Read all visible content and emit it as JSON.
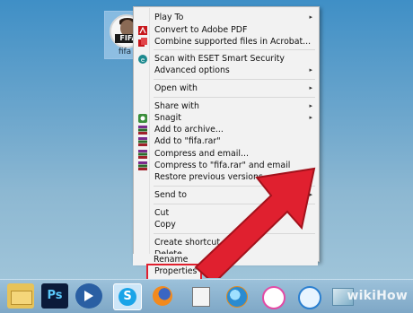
{
  "desktop": {
    "file": {
      "badge": "FIFA",
      "name": "fifa"
    }
  },
  "menu": {
    "items": [
      {
        "label": "Play To",
        "icon": "",
        "submenu": true
      },
      {
        "label": "Convert to Adobe PDF",
        "icon": "adobe-pdf-icon",
        "submenu": false
      },
      {
        "label": "Combine supported files in Acrobat...",
        "icon": "acrobat-combine-icon",
        "submenu": false
      },
      {
        "label": "Scan with ESET Smart Security",
        "icon": "eset-icon",
        "submenu": false
      },
      {
        "label": "Advanced options",
        "icon": "",
        "submenu": true
      },
      {
        "label": "Open with",
        "icon": "",
        "submenu": true
      },
      {
        "label": "Share with",
        "icon": "",
        "submenu": true
      },
      {
        "label": "Snagit",
        "icon": "snagit-icon",
        "submenu": true
      },
      {
        "label": "Add to archive...",
        "icon": "winrar-icon",
        "submenu": false
      },
      {
        "label": "Add to \"fifa.rar\"",
        "icon": "winrar-icon",
        "submenu": false
      },
      {
        "label": "Compress and email...",
        "icon": "winrar-icon",
        "submenu": false
      },
      {
        "label": "Compress to \"fifa.rar\" and email",
        "icon": "winrar-icon",
        "submenu": false
      },
      {
        "label": "Restore previous versions",
        "icon": "",
        "submenu": false
      },
      {
        "label": "Send to",
        "icon": "",
        "submenu": true
      },
      {
        "label": "Cut",
        "icon": "",
        "submenu": false
      },
      {
        "label": "Copy",
        "icon": "",
        "submenu": false
      },
      {
        "label": "Create shortcut",
        "icon": "",
        "submenu": false
      },
      {
        "label": "Delete",
        "icon": "",
        "submenu": false
      },
      {
        "label": "Rename",
        "icon": "",
        "submenu": false
      },
      {
        "label": "Properties",
        "icon": "",
        "submenu": false
      }
    ],
    "submenu_arrow": "▸"
  },
  "taskbar": {
    "apps": [
      {
        "name": "file-explorer-icon"
      },
      {
        "name": "photoshop-icon",
        "text": "Ps"
      },
      {
        "name": "media-player-icon"
      },
      {
        "name": "skype-icon",
        "text": "S"
      },
      {
        "name": "firefox-icon"
      },
      {
        "name": "calculator-icon"
      },
      {
        "name": "network-globe-icon"
      },
      {
        "name": "itunes-icon"
      },
      {
        "name": "safari-icon"
      },
      {
        "name": "recycle-bin-icon"
      }
    ]
  },
  "watermark": "wikiHow",
  "colors": {
    "highlight_red": "#e0202f",
    "arrow_red": "#e0202f"
  }
}
